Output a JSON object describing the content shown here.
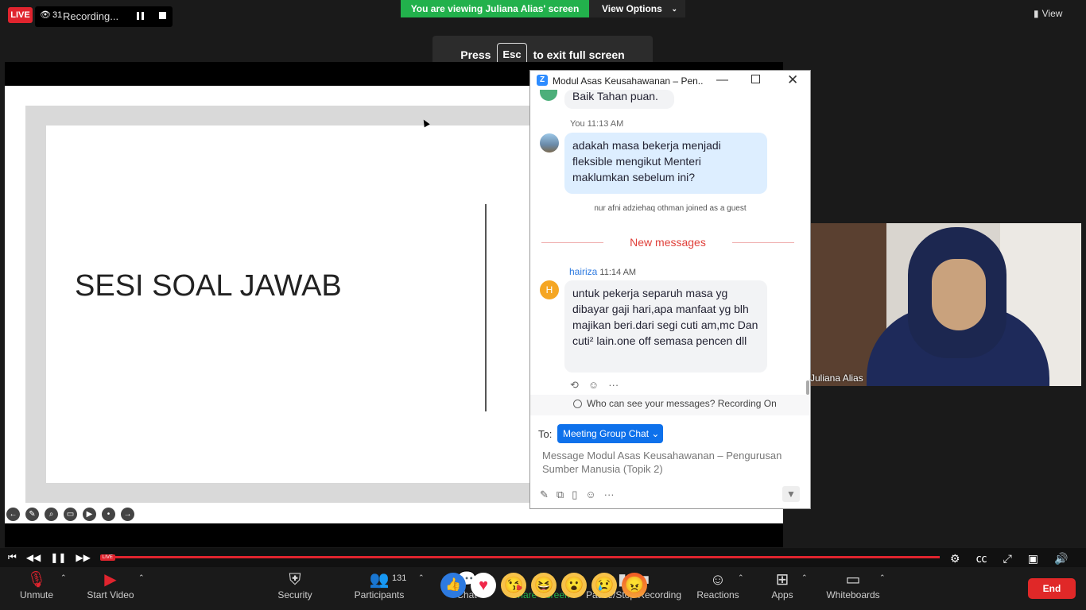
{
  "top_bar": {
    "live_label": "LIVE",
    "viewer_count": "31",
    "recording_label": "Recording...",
    "viewing_banner": "You are viewing Juliana Alias' screen",
    "view_options_label": "View Options",
    "view_label": "View",
    "esc_prefix": "Press",
    "esc_key": "Esc",
    "esc_suffix": "to exit full screen"
  },
  "slide": {
    "title": "SESI SOAL JAWAB"
  },
  "chat_window": {
    "title": "Modul Asas Keusahawanan – Pen...",
    "previous_message": "Baik Tahan puan.",
    "you_sender": "You",
    "you_time": "11:13 AM",
    "you_message": "adakah masa bekerja menjadi fleksible mengikut Menteri maklumkan sebelum ini?",
    "join_notice": "nur afni adziehaq othman joined as a guest",
    "new_messages_label": "New messages",
    "hairiza_sender": "hairiza",
    "hairiza_time": "11:14 AM",
    "hairiza_avatar_letter": "H",
    "hairiza_message": "untuk pekerja separuh masa yg dibayar gaji hari,apa manfaat yg blh majikan beri.dari segi cuti am,mc Dan cuti² lain.one off semasa pencen dll",
    "who_can_see": "Who can see your messages? Recording On",
    "to_label": "To:",
    "recipient": "Meeting Group Chat",
    "input_placeholder": "Message Modul Asas Keusahawanan – Pengurusan Sumber Manusia (Topik 2)"
  },
  "video_tile": {
    "participant_name": "Juliana Alias"
  },
  "toolbar": {
    "unmute_label": "Unmute",
    "start_video_label": "Start Video",
    "security_label": "Security",
    "participants_label": "Participants",
    "participant_count": "131",
    "chat_label": "Chat",
    "share_screen_label": "Share Screen",
    "record_label": "Pause/Stop Recording",
    "reactions_label": "Reactions",
    "apps_label": "Apps",
    "whiteboards_label": "Whiteboards",
    "end_label": "End"
  },
  "playback": {
    "live_tag": "LIVE"
  },
  "reactions": [
    "like",
    "heart",
    "kiss",
    "laugh",
    "wow",
    "sad",
    "angry"
  ],
  "colors": {
    "live_red": "#e0242e",
    "share_green": "#22b14c",
    "zoom_blue": "#0e71eb",
    "new_messages_red": "#e0403a"
  }
}
